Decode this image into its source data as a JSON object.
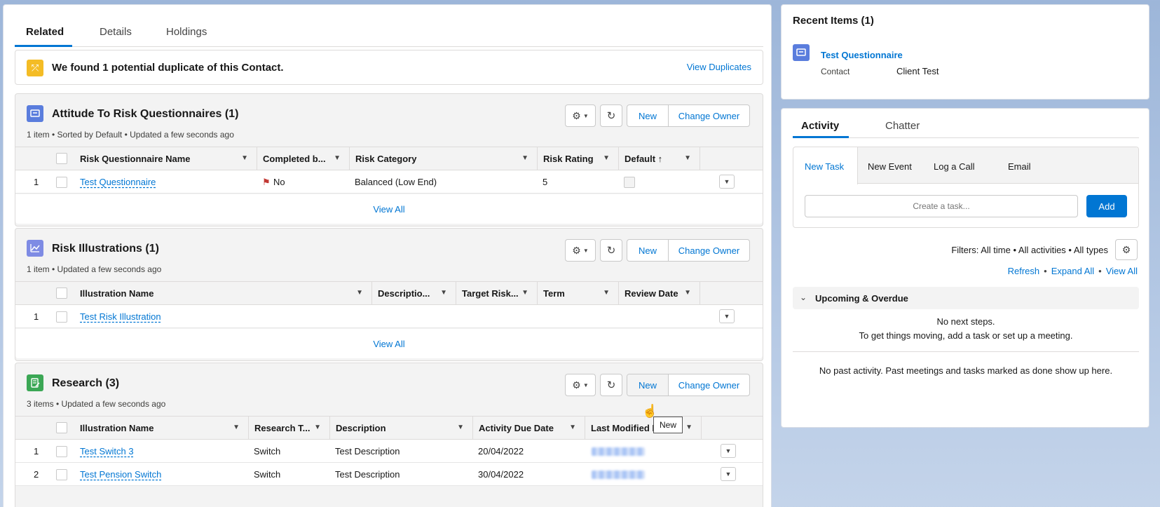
{
  "tabs": [
    "Related",
    "Details",
    "Holdings"
  ],
  "duplicate": {
    "message": "We found 1 potential duplicate of this Contact.",
    "action": "View Duplicates"
  },
  "buttons": {
    "new": "New",
    "change_owner": "Change Owner",
    "view_all": "View All"
  },
  "atr": {
    "title": "Attitude To Risk Questionnaires (1)",
    "subtitle": "1 item • Sorted by Default • Updated a few seconds ago",
    "columns": [
      "Risk Questionnaire Name",
      "Completed b...",
      "Risk Category",
      "Risk Rating",
      "Default ↑"
    ],
    "rows": [
      {
        "num": "1",
        "name": "Test Questionnaire",
        "completed": "No",
        "category": "Balanced (Low End)",
        "rating": "5"
      }
    ]
  },
  "illus": {
    "title": "Risk Illustrations (1)",
    "subtitle": "1 item • Updated a few seconds ago",
    "columns": [
      "Illustration Name",
      "Descriptio...",
      "Target Risk...",
      "Term",
      "Review Date"
    ],
    "rows": [
      {
        "num": "1",
        "name": "Test Risk Illustration"
      }
    ]
  },
  "research": {
    "title": "Research (3)",
    "subtitle": "3 items • Updated a few seconds ago",
    "columns": [
      "Illustration Name",
      "Research T...",
      "Description",
      "Activity Due Date",
      "Last Modified By"
    ],
    "rows": [
      {
        "num": "1",
        "name": "Test Switch 3",
        "type": "Switch",
        "desc": "Test Description",
        "due": "20/04/2022"
      },
      {
        "num": "2",
        "name": "Test Pension Switch",
        "type": "Switch",
        "desc": "Test Description",
        "due": "30/04/2022"
      }
    ]
  },
  "tooltip": "New",
  "recent": {
    "title": "Recent Items (1)",
    "item_name": "Test Questionnaire",
    "field_label": "Contact",
    "field_value": "Client Test"
  },
  "activity": {
    "tabs": [
      "Activity",
      "Chatter"
    ],
    "subtabs": [
      "New Task",
      "New Event",
      "Log a Call",
      "Email"
    ],
    "task_placeholder": "Create a task...",
    "add": "Add",
    "filters": "Filters: All time • All activities • All types",
    "links": [
      "Refresh",
      "Expand All",
      "View All"
    ],
    "upcoming": "Upcoming & Overdue",
    "no_next": "No next steps.",
    "no_next_hint": "To get things moving, add a task or set up a meeting.",
    "no_past": "No past activity. Past meetings and tasks marked as done show up here."
  },
  "colors": {
    "brand": "#0176d3",
    "atr_icon": "#5a7ddd",
    "illus_icon": "#7e8be4",
    "research_icon": "#3ba755",
    "dup_icon": "#f4bc25"
  }
}
